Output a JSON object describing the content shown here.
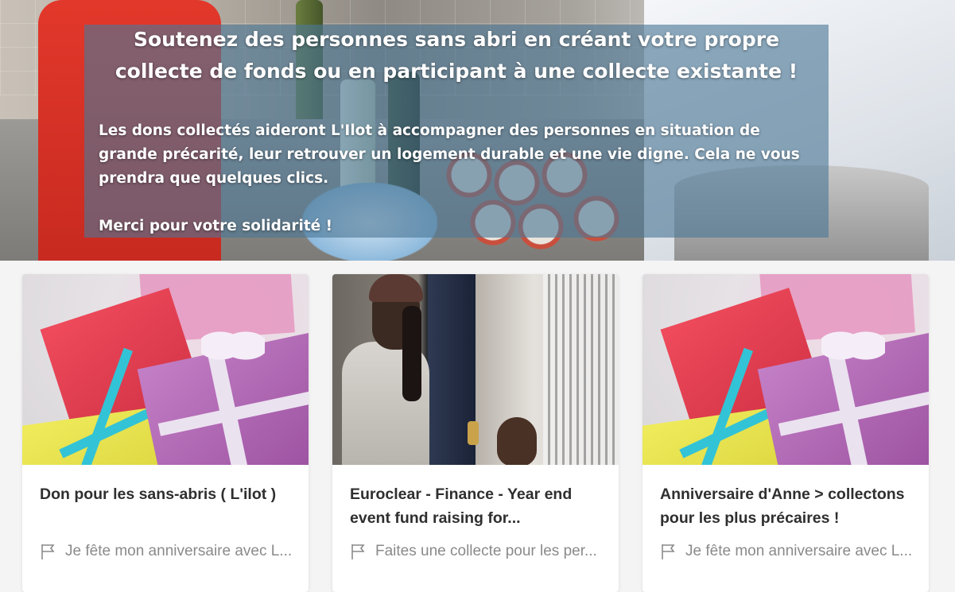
{
  "hero": {
    "title": "Soutenez des personnes sans abri en créant votre propre collecte de fonds ou en participant à une collecte existante !",
    "body": "Les dons collectés aideront L'Ilot à accompagner des personnes en situation de grande précarité, leur retrouver un logement durable et une vie digne. Cela ne vous prendra que quelques clics.",
    "thanks": "Merci pour votre solidarité !"
  },
  "cards": [
    {
      "image": "gift-boxes",
      "title": "Don pour les sans-abris ( L'ilot )",
      "tag_icon": "flag-icon",
      "tag": "Je fête mon anniversaire avec L..."
    },
    {
      "image": "woman-and-child-at-door",
      "title": "Euroclear - Finance - Year end event fund raising for...",
      "tag_icon": "flag-icon",
      "tag": "Faites une collecte pour les per..."
    },
    {
      "image": "gift-boxes",
      "title": "Anniversaire d'Anne > collectons pour les plus précaires !",
      "tag_icon": "flag-icon",
      "tag": "Je fête mon anniversaire avec L..."
    }
  ],
  "colors": {
    "overlay": "#4c7896",
    "page_bg": "#f4f4f4",
    "title_text": "#2f2f2f",
    "tag_text": "#8a8a8a"
  }
}
